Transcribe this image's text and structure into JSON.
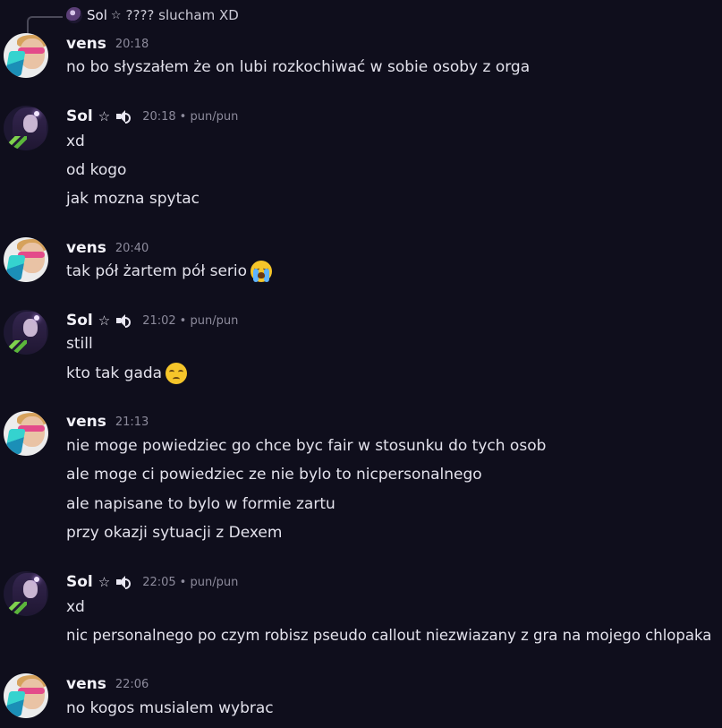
{
  "reply": {
    "author": "Sol",
    "star": "☆",
    "text": "???? slucham XD"
  },
  "messages": [
    {
      "author": "vens",
      "time": "20:18",
      "avatar": "vens-avatar",
      "lines": [
        "no bo słyszałem że on lubi rozkochiwać w sobie osoby z orga"
      ]
    },
    {
      "author": "Sol",
      "star": "☆",
      "voice_icon": "speaker-icon",
      "time": "20:18",
      "tag": "• pun/pun",
      "avatar": "sol-avatar",
      "lines": [
        "xd",
        "od kogo",
        "jak mozna spytac"
      ]
    },
    {
      "author": "vens",
      "time": "20:40",
      "avatar": "vens-avatar",
      "lines": [
        "tak pół żartem pół serio"
      ],
      "emoji": "loudly-crying-face-emoji"
    },
    {
      "author": "Sol",
      "star": "☆",
      "voice_icon": "speaker-icon",
      "time": "21:02",
      "tag": "• pun/pun",
      "avatar": "sol-avatar",
      "lines": [
        "still",
        "kto tak gada"
      ],
      "emoji": "pensive-face-emoji"
    },
    {
      "author": "vens",
      "time": "21:13",
      "avatar": "vens-avatar",
      "lines": [
        "nie moge powiedziec go chce byc fair w stosunku do tych osob",
        "ale moge ci powiedziec ze nie bylo to nicpersonalnego",
        "ale napisane to bylo w formie zartu",
        "przy okazji sytuacji z Dexem"
      ]
    },
    {
      "author": "Sol",
      "star": "☆",
      "voice_icon": "speaker-icon",
      "time": "22:05",
      "tag": "• pun/pun",
      "avatar": "sol-avatar",
      "lines": [
        "xd",
        "nic personalnego po czym robisz pseudo callout niezwiazany z gra na mojego chlopaka"
      ]
    },
    {
      "author": "vens",
      "time": "22:06",
      "avatar": "vens-avatar",
      "lines": [
        "no kogos musialem wybrac"
      ]
    }
  ]
}
